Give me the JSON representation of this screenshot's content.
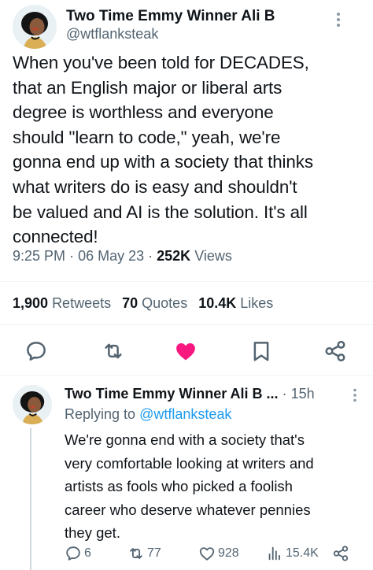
{
  "tweet": {
    "display_name": "Two Time Emmy Winner Ali B",
    "handle": "@wtflanksteak",
    "text": "When you've been told for DECADES,\nthat an English major or liberal arts\ndegree is worthless and everyone\nshould \"learn to code,\" yeah, we're\ngonna end up with a society that thinks\nwhat writers do is easy and shouldn't\nbe valued and AI is the solution. It's all\nconnected!",
    "time": "9:25 PM",
    "date": "06 May 23",
    "views_count": "252K",
    "views_label": "Views",
    "retweets_count": "1,900",
    "retweets_label": "Retweets",
    "quotes_count": "70",
    "quotes_label": "Quotes",
    "likes_count": "10.4K",
    "likes_label": "Likes",
    "actions": [
      "reply-icon",
      "retweet-icon",
      "like-icon",
      "bookmark-icon",
      "share-icon"
    ]
  },
  "reply": {
    "display_name": "Two Time Emmy Winner Ali B ...",
    "time": "15h",
    "replying_prefix": "Replying to",
    "replying_to": "@wtflanksteak",
    "text": "We're gonna end with a society that's\nvery comfortable looking at writers and\nartists as fools who picked a foolish\ncareer who deserve whatever pennies\nthey get.",
    "replies": "6",
    "retweets": "77",
    "likes": "928",
    "views": "15.4K"
  },
  "colors": {
    "text": "#0f1419",
    "secondary": "#536471",
    "link": "#1d9bf0",
    "like": "#f91880",
    "divider": "#eff3f4"
  }
}
